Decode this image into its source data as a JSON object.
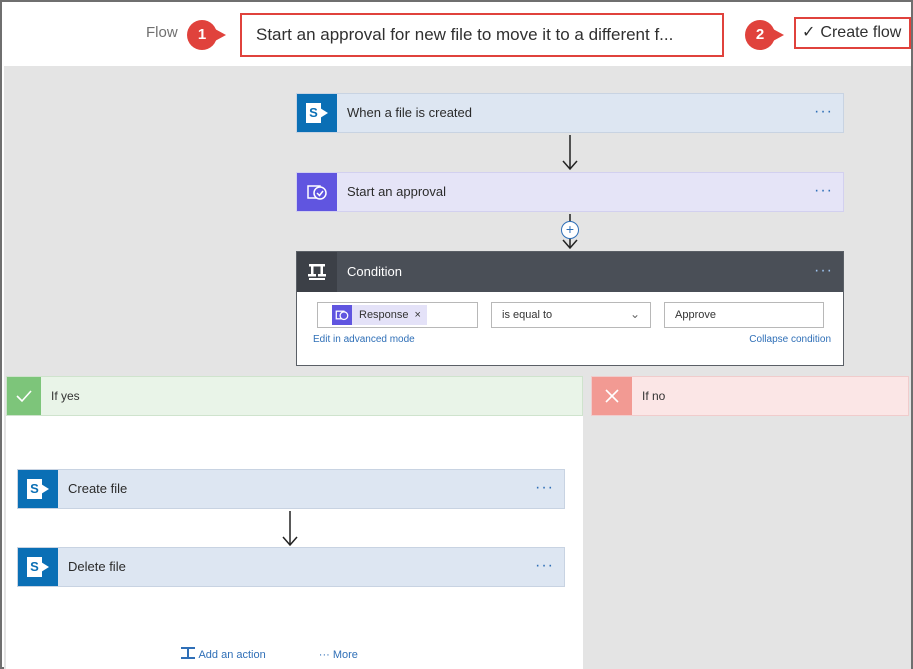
{
  "header": {
    "breadcrumb": "Flow",
    "flow_name": "Start an approval for new file to move it to a different f...",
    "create_button": "Create flow",
    "callouts": [
      "1",
      "2"
    ],
    "accent_red": "#e0423c"
  },
  "steps": [
    {
      "label": "When a file is created",
      "icon": "sharepoint-icon",
      "more": "···"
    },
    {
      "label": "Start an approval",
      "icon": "approval-icon",
      "more": "···"
    }
  ],
  "condition": {
    "title": "Condition",
    "more": "···",
    "left_token": "Response",
    "token_remove": "×",
    "operator": "is equal to",
    "value": "Approve",
    "edit_link": "Edit in advanced mode",
    "collapse_link": "Collapse condition"
  },
  "branches": {
    "yes": {
      "label": "If yes",
      "actions": [
        {
          "label": "Create file",
          "more": "···"
        },
        {
          "label": "Delete file",
          "more": "···"
        }
      ],
      "add_action": "Add an action",
      "more": "More",
      "more_dots": "···"
    },
    "no": {
      "label": "If no"
    }
  },
  "colors": {
    "sharepoint": "#0a6fb5",
    "approval": "#6055e0",
    "condition_header": "#4a4f57",
    "yes_green": "#7dc57a",
    "no_red": "#f29a93",
    "link_blue": "#2f6fb7"
  }
}
